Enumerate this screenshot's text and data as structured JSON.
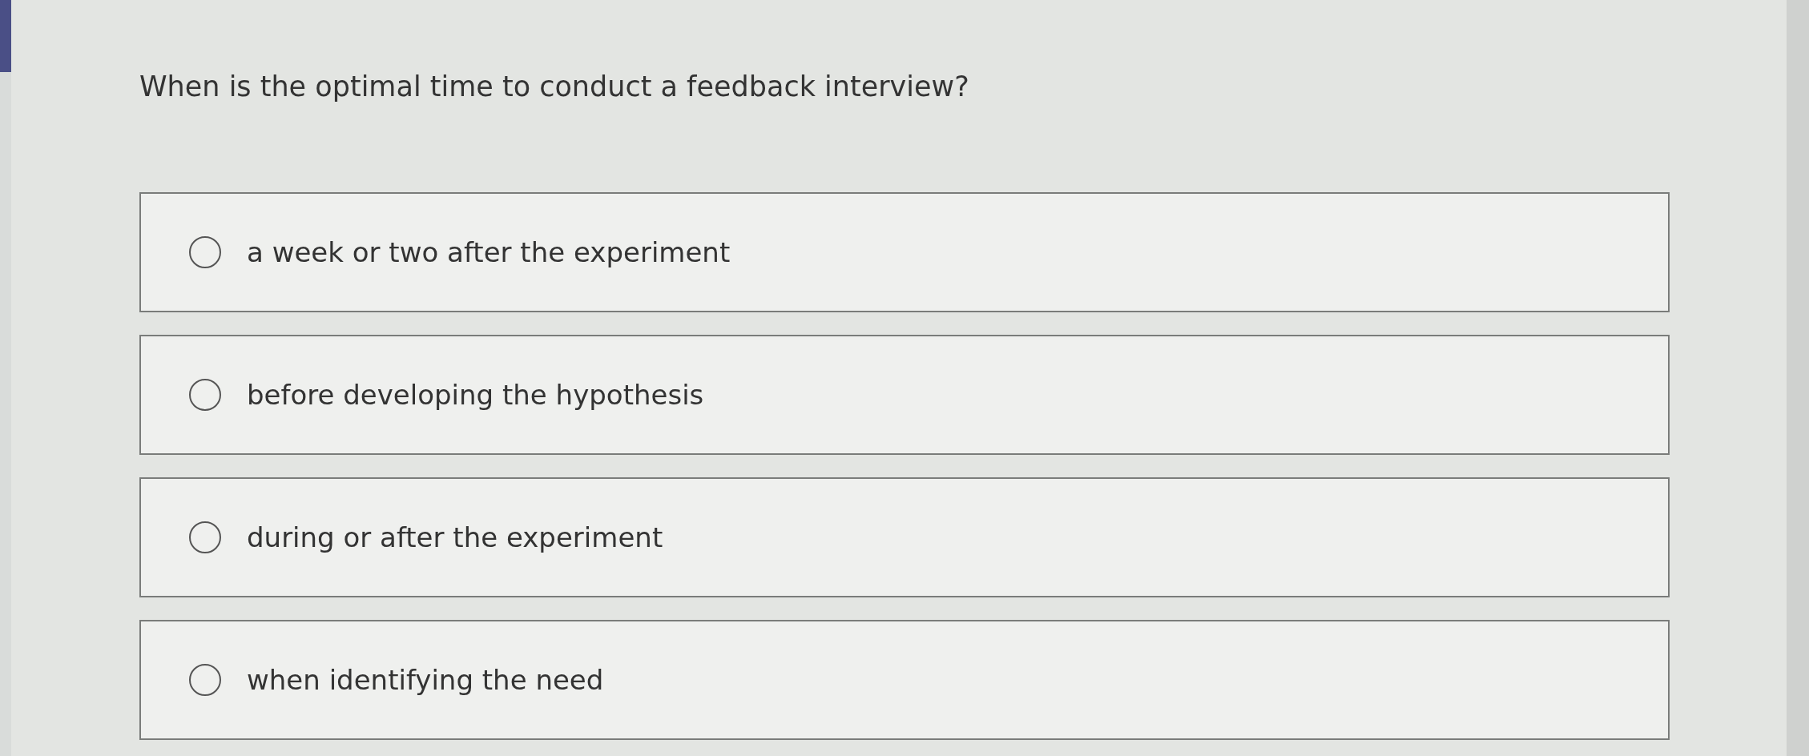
{
  "question": "When is the optimal time to conduct a feedback interview?",
  "options": [
    {
      "label": "a week or two after the experiment",
      "selected": false
    },
    {
      "label": "before developing the hypothesis",
      "selected": false
    },
    {
      "label": "during or after the experiment",
      "selected": false
    },
    {
      "label": "when identifying the need",
      "selected": false
    }
  ]
}
